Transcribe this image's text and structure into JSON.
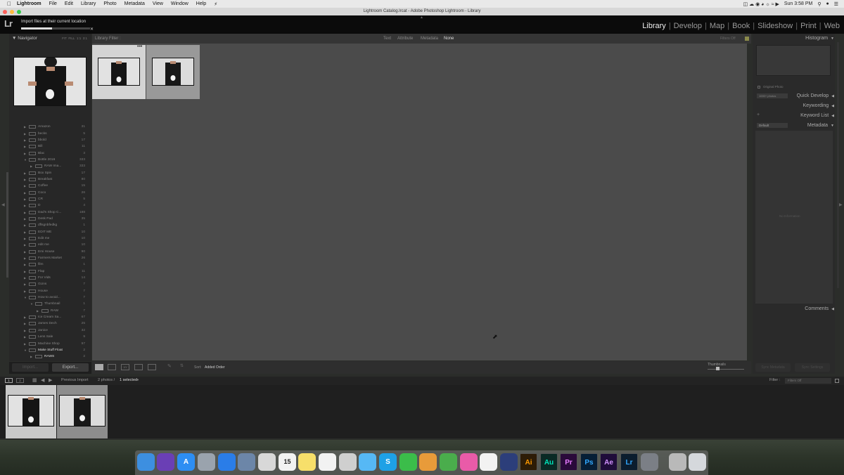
{
  "menubar": {
    "apple_icon": "apple-icon",
    "items": [
      "Lightroom",
      "File",
      "Edit",
      "Library",
      "Photo",
      "Metadata",
      "View",
      "Window",
      "Help"
    ],
    "clock": "Sun 3:58 PM"
  },
  "window": {
    "title": "Lightroom Catalog.lrcat - Adobe Photoshop Lightroom - Library"
  },
  "app": {
    "logo": "Lr",
    "import_message": "Import files at their current location",
    "import_progress": 0.45,
    "modules": [
      "Library",
      "Develop",
      "Map",
      "Book",
      "Slideshow",
      "Print",
      "Web"
    ],
    "active_module": "Library"
  },
  "navigator": {
    "title": "Navigator",
    "options": [
      "FIT",
      "FILL",
      "1:1",
      "3:1"
    ]
  },
  "folders": [
    {
      "name": "Amazon",
      "count": "31"
    },
    {
      "name": "becks",
      "count": "5"
    },
    {
      "name": "bbold",
      "count": "17"
    },
    {
      "name": "Bill",
      "count": "11"
    },
    {
      "name": "Blac",
      "count": "3"
    },
    {
      "name": "Bottle 2016",
      "count": "333",
      "expanded": true
    },
    {
      "name": "RAW Ima...",
      "count": "333",
      "child": true
    },
    {
      "name": "Box Spin",
      "count": "17"
    },
    {
      "name": "Breakfast",
      "count": "80"
    },
    {
      "name": "Coffee",
      "count": "15"
    },
    {
      "name": "Coco",
      "count": "26"
    },
    {
      "name": "CR",
      "count": "5"
    },
    {
      "name": "D",
      "count": "4"
    },
    {
      "name": "Dad's Shop C...",
      "count": "188"
    },
    {
      "name": "Desk Pad",
      "count": "35"
    },
    {
      "name": "dflsgnbfedkg",
      "count": "1"
    },
    {
      "name": "EDIT ME",
      "count": "10"
    },
    {
      "name": "Edit me",
      "count": "10"
    },
    {
      "name": "edit me",
      "count": "10"
    },
    {
      "name": "Emi House",
      "count": "90"
    },
    {
      "name": "Farmers Market",
      "count": "26"
    },
    {
      "name": "film",
      "count": "1"
    },
    {
      "name": "Flap",
      "count": "11"
    },
    {
      "name": "For Vids",
      "count": "14"
    },
    {
      "name": "GUns",
      "count": "7"
    },
    {
      "name": "House",
      "count": "7"
    },
    {
      "name": "How to avoid...",
      "count": "7",
      "expanded": true
    },
    {
      "name": "Thumbnail",
      "count": "1",
      "child": true,
      "expanded": true
    },
    {
      "name": "RAW",
      "count": "7",
      "child2": true
    },
    {
      "name": "Ice Cream Sa...",
      "count": "67"
    },
    {
      "name": "James Dech",
      "count": "25"
    },
    {
      "name": "Janice",
      "count": "32"
    },
    {
      "name": "Lens Sale",
      "count": "9"
    },
    {
      "name": "Machine Shop",
      "count": "97"
    },
    {
      "name": "Make Stuff Float",
      "count": "2",
      "expanded": true,
      "selected": true
    },
    {
      "name": "RAWS",
      "count": "2",
      "child": true,
      "selected": true
    }
  ],
  "left_buttons": {
    "import": "Import...",
    "export": "Export..."
  },
  "filter_bar": {
    "title": "Library Filter :",
    "options": [
      "Text",
      "Attribute",
      "Metadata",
      "None"
    ],
    "active": "None",
    "preset": "Filters Off"
  },
  "toolbar": {
    "sort_label": "Sort:",
    "sort_value": "Added Order",
    "thumbnails_label": "Thumbnails"
  },
  "right_panel": {
    "histogram": "Histogram",
    "original_photo": "Original Photo",
    "photos_label": "1000+ photos",
    "quick_develop": "Quick Develop",
    "keywording": "Keywording",
    "keyword_list": "Keyword List",
    "metadata_preset": "Default",
    "metadata": "Metadata",
    "no_information": "No Information",
    "comments": "Comments",
    "sync_metadata": "Sync Metadata",
    "sync_settings": "Sync Settings"
  },
  "filmstrip_bar": {
    "pages": [
      "1",
      "2"
    ],
    "source": "Previous Import",
    "count": "2 photos /",
    "selected": "1 selected",
    "filter_label": "Filter :",
    "filter_value": "Filters Off"
  },
  "dock": {
    "apps": [
      {
        "name": "finder",
        "label": "",
        "color": "#3d8fe0"
      },
      {
        "name": "siri",
        "label": "",
        "color": "#6a3fb5"
      },
      {
        "name": "app-store",
        "label": "A",
        "color": "#2d8ef3"
      },
      {
        "name": "launchpad",
        "label": "",
        "color": "#9aa3ad"
      },
      {
        "name": "safari",
        "label": "",
        "color": "#2a7de8"
      },
      {
        "name": "preview",
        "label": "",
        "color": "#6c86a8"
      },
      {
        "name": "chrome",
        "label": "",
        "color": "#d8d8d8"
      },
      {
        "name": "calendar",
        "label": "15",
        "color": "#f2f2f2"
      },
      {
        "name": "notes",
        "label": "",
        "color": "#f7df6a"
      },
      {
        "name": "reminders",
        "label": "",
        "color": "#f2f2f2"
      },
      {
        "name": "photo-booth",
        "label": "",
        "color": "#cfcfcf"
      },
      {
        "name": "messages",
        "label": "",
        "color": "#56b8f5"
      },
      {
        "name": "skype",
        "label": "S",
        "color": "#1ea1e6"
      },
      {
        "name": "facetime",
        "label": "",
        "color": "#3bbd4a"
      },
      {
        "name": "pages",
        "label": "",
        "color": "#e89b3a"
      },
      {
        "name": "numbers",
        "label": "",
        "color": "#4aad4c"
      },
      {
        "name": "itunes",
        "label": "",
        "color": "#e95ba8"
      },
      {
        "name": "photos",
        "label": "",
        "color": "#f2f2f2"
      },
      {
        "name": "quicktime",
        "label": "",
        "color": "#2c3e7a"
      },
      {
        "name": "illustrator",
        "label": "Ai",
        "color": "#2d1c07"
      },
      {
        "name": "audition",
        "label": "Au",
        "color": "#0a2a25"
      },
      {
        "name": "premiere",
        "label": "Pr",
        "color": "#2a0a3a"
      },
      {
        "name": "photoshop",
        "label": "Ps",
        "color": "#061e36"
      },
      {
        "name": "after-effects",
        "label": "Ae",
        "color": "#1f0c3a"
      },
      {
        "name": "lightroom",
        "label": "Lr",
        "color": "#0b1d2e"
      },
      {
        "name": "system-preferences",
        "label": "",
        "color": "#7b7f86"
      },
      {
        "name": "image-capture",
        "label": "",
        "color": "#b9b9b9"
      },
      {
        "name": "trash",
        "label": "",
        "color": "#d5d8dc"
      }
    ]
  }
}
